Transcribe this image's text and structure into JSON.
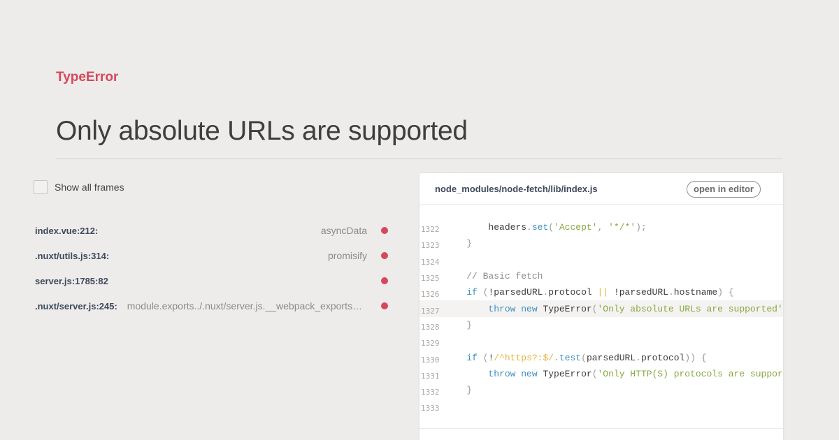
{
  "error": {
    "type": "TypeError",
    "message": "Only absolute URLs are supported"
  },
  "frames_toggle": {
    "label": "Show all frames",
    "checked": false
  },
  "frames": [
    {
      "file": "index.vue:212:",
      "function": "asyncData"
    },
    {
      "file": ".nuxt/utils.js:314:",
      "function": "promisify"
    },
    {
      "file": "server.js:1785:82",
      "function": ""
    },
    {
      "file": ".nuxt/server.js:245:",
      "function": "module.exports../.nuxt/server.js.__webpack_exports__.default"
    }
  ],
  "code_panel": {
    "file_path": "node_modules/node-fetch/lib/index.js",
    "open_editor_label": "open in editor",
    "highlighted_line": 1327,
    "lines": [
      {
        "number": "1322",
        "code": "        headers.set('Accept', '*/*');"
      },
      {
        "number": "1323",
        "code": "    }"
      },
      {
        "number": "1324",
        "code": ""
      },
      {
        "number": "1325",
        "code": "    // Basic fetch"
      },
      {
        "number": "1326",
        "code": "    if (!parsedURL.protocol || !parsedURL.hostname) {"
      },
      {
        "number": "1327",
        "code": "        throw new TypeError('Only absolute URLs are supported');"
      },
      {
        "number": "1328",
        "code": "    }"
      },
      {
        "number": "1329",
        "code": ""
      },
      {
        "number": "1330",
        "code": "    if (!/^https?:$/.test(parsedURL.protocol)) {"
      },
      {
        "number": "1331",
        "code": "        throw new TypeError('Only HTTP(S) protocols are supported');"
      },
      {
        "number": "1332",
        "code": "    }"
      },
      {
        "number": "1333",
        "code": ""
      }
    ]
  },
  "colors": {
    "accent": "#d6475b",
    "background": "#edecea",
    "keyword": "#3c8ec4",
    "string": "#86a83f",
    "regex": "#e8b23c",
    "comment": "#8c8c8c"
  }
}
